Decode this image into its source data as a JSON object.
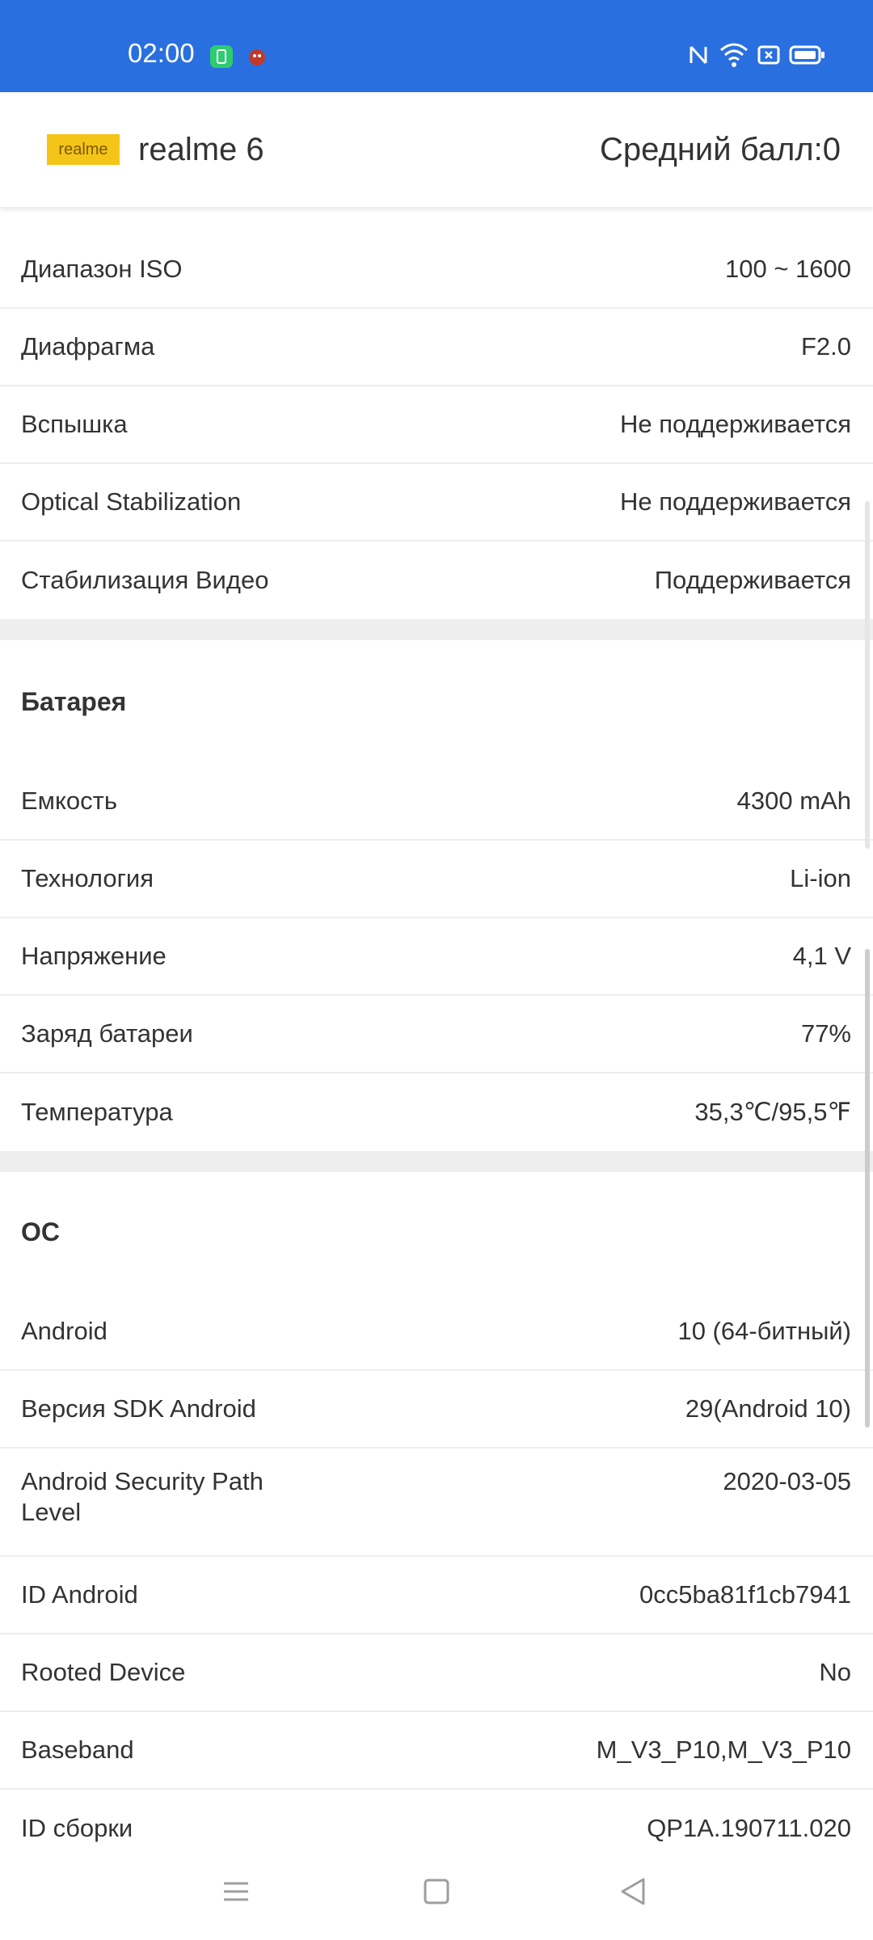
{
  "status_bar": {
    "time": "02:00",
    "color": "#2a6fe0",
    "icons": [
      "battery-saver-app-icon",
      "bug-app-icon",
      "nfc-icon",
      "wifi-icon",
      "sim-icon",
      "battery-icon"
    ]
  },
  "header": {
    "brand": "realme",
    "device": "realme 6",
    "avg_score": "Средний балл:0"
  },
  "camera_rows": [
    {
      "label": "Диапазон ISO",
      "value": "100 ~ 1600"
    },
    {
      "label": "Диафрагма",
      "value": "F2.0"
    },
    {
      "label": "Вспышка",
      "value": "Не поддерживается"
    },
    {
      "label": "Optical Stabilization",
      "value": "Не поддерживается"
    },
    {
      "label": "Стабилизация Видео",
      "value": "Поддерживается"
    }
  ],
  "battery": {
    "title": "Батарея",
    "rows": [
      {
        "label": "Емкость",
        "value": "4300 mAh"
      },
      {
        "label": "Технология",
        "value": "Li-ion"
      },
      {
        "label": "Напряжение",
        "value": "4,1 V"
      },
      {
        "label": "Заряд батареи",
        "value": "77%"
      },
      {
        "label": "Температура",
        "value": "35,3℃/95,5℉"
      }
    ]
  },
  "os": {
    "title": "ОС",
    "rows": [
      {
        "label": "Android",
        "value": "10 (64-битный)"
      },
      {
        "label": "Версия SDK Android",
        "value": "29(Android 10)"
      },
      {
        "label": "Android Security Path Level",
        "value": "2020-03-05"
      },
      {
        "label": "ID Android",
        "value": "0cc5ba81f1cb7941"
      },
      {
        "label": "Rooted Device",
        "value": "No"
      },
      {
        "label": "Baseband",
        "value": "M_V3_P10,M_V3_P10"
      },
      {
        "label": "ID сборки",
        "value": "QP1A.190711.020"
      }
    ]
  },
  "nav_bar": {
    "buttons": [
      "menu-icon",
      "home-icon",
      "back-icon"
    ]
  }
}
